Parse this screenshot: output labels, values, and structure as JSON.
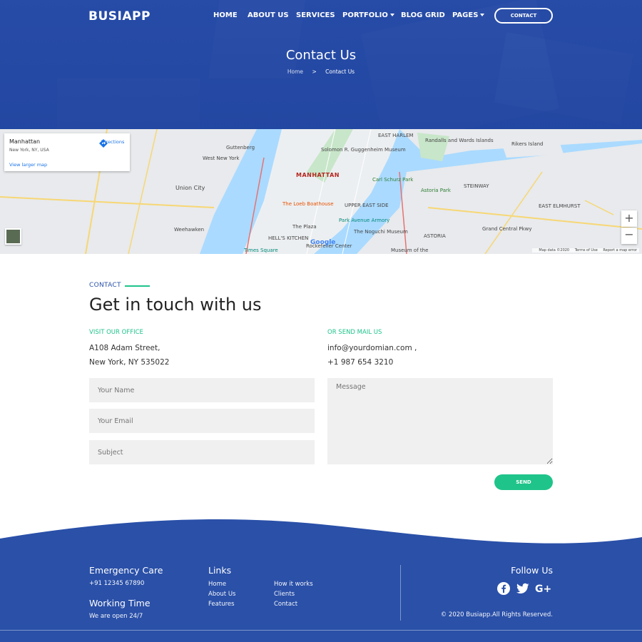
{
  "header": {
    "logo": "BUSIAPP",
    "nav": [
      {
        "label": "HOME"
      },
      {
        "label": "ABOUT US"
      },
      {
        "label": "SERVICES"
      },
      {
        "label": "PORTFOLIO"
      },
      {
        "label": "BLOG GRID"
      },
      {
        "label": "PAGES"
      }
    ],
    "contact_button": "CONTACT"
  },
  "hero": {
    "title": "Contact Us",
    "breadcrumb_home": "Home",
    "breadcrumb_sep": ">",
    "breadcrumb_current": "Contact Us"
  },
  "map": {
    "card_title": "Manhattan",
    "card_subtitle": "New York, NY, USA",
    "directions": "Directions",
    "larger_map": "View larger map",
    "labels": {
      "manhattan": "MANHATTAN",
      "union_city": "Union City",
      "guttenberg": "Guttenberg",
      "west_new_york": "West New York",
      "weehawken": "Weehawken",
      "east_harlem": "EAST HARLEM",
      "randalls": "Randalls and Wards Islands",
      "rikers": "Rikers Island",
      "astoria_park": "Astoria Park",
      "steinway": "STEINWAY",
      "east_elmhurst": "EAST ELMHURST",
      "upper_east_side": "UPPER EAST SIDE",
      "loeb": "The Loeb Boathouse",
      "park_avenue_armory": "Park Avenue Armory",
      "plaza": "The Plaza",
      "hells_kitchen": "HELL'S KITCHEN",
      "noguchi": "The Noguchi Museum",
      "astoria": "ASTORIA",
      "times_square": "Times Square",
      "rockefeller": "Rockefeller Center",
      "guggenheim": "Solomon R. Guggenheim Museum",
      "carl_schurz": "Carl Schurz Park",
      "grand_central_pkwy": "Grand Central Pkwy",
      "museum_moving": "Museum of the"
    },
    "footer_data": "Map data ©2020",
    "footer_terms": "Terms of Use",
    "footer_report": "Report a map error",
    "google": "Google"
  },
  "contact": {
    "eyebrow": "CONTACT",
    "heading": "Get in touch with us",
    "office_label": "VISIT OUR OFFICE",
    "address_line1": "A108 Adam Street,",
    "address_line2": "New York, NY 535022",
    "mail_label": "OR SEND MAIL US",
    "email": "info@yourdomian.com ,",
    "phone": "+1 987 654 3210",
    "name_placeholder": "Your Name",
    "email_placeholder": "Your Email",
    "subject_placeholder": "Subject",
    "message_placeholder": "Message",
    "send": "SEND"
  },
  "footer": {
    "emergency_title": "Emergency Care",
    "emergency_phone": "+91 12345 67890",
    "working_title": "Working Time",
    "working_text": "We are open 24/7",
    "links_title": "Links",
    "links_col1": [
      "Home",
      "About Us",
      "Features"
    ],
    "links_col2": [
      "How it works",
      "Clients",
      "Contact"
    ],
    "follow_title": "Follow Us",
    "copyright": "© 2020 Busiapp.All Rights Reserved."
  },
  "colors": {
    "primary": "#2a50a8",
    "accent": "#1fc48a"
  }
}
